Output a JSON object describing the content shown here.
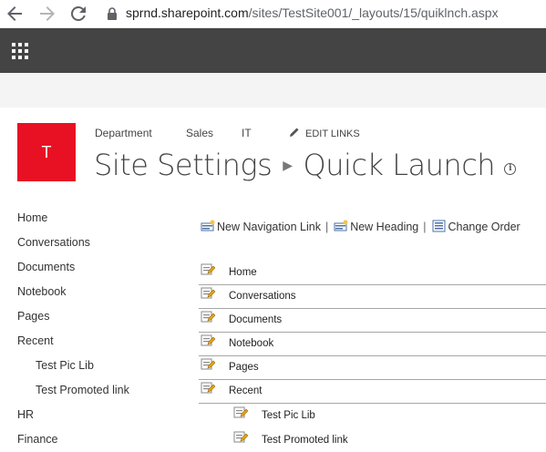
{
  "browser": {
    "url_host": "sprnd.sharepoint.com",
    "url_path": "/sites/TestSite001/_layouts/15/quiklnch.aspx"
  },
  "site": {
    "logo_letter": "T",
    "logo_color": "#e81123",
    "top_nav": [
      "Department",
      "Sales",
      "IT"
    ],
    "edit_links_label": "EDIT LINKS",
    "title_part1": "Site Settings",
    "title_part2": "Quick Launch"
  },
  "left_nav": {
    "items": [
      {
        "label": "Home",
        "level": 0
      },
      {
        "label": "Conversations",
        "level": 0
      },
      {
        "label": "Documents",
        "level": 0
      },
      {
        "label": "Notebook",
        "level": 0
      },
      {
        "label": "Pages",
        "level": 0
      },
      {
        "label": "Recent",
        "level": 0
      },
      {
        "label": "Test Pic Lib",
        "level": 1
      },
      {
        "label": "Test Promoted link",
        "level": 1
      },
      {
        "label": "HR",
        "level": 0
      },
      {
        "label": "Finance",
        "level": 0
      }
    ]
  },
  "toolbar": {
    "new_link": "New Navigation Link",
    "new_heading": "New Heading",
    "change_order": "Change Order",
    "separator": "|"
  },
  "links": [
    {
      "label": "Home",
      "level": 0
    },
    {
      "label": "Conversations",
      "level": 0
    },
    {
      "label": "Documents",
      "level": 0
    },
    {
      "label": "Notebook",
      "level": 0
    },
    {
      "label": "Pages",
      "level": 0
    },
    {
      "label": "Recent",
      "level": 0
    },
    {
      "label": "Test Pic Lib",
      "level": 1
    },
    {
      "label": "Test Promoted link",
      "level": 1
    }
  ],
  "icons": {
    "back": "arrow-left-icon",
    "forward": "arrow-right-icon",
    "reload": "reload-icon",
    "lock": "lock-icon",
    "app_launcher": "waffle-icon",
    "edit": "pencil-icon",
    "edit_link": "edit-link-icon",
    "info": "info-icon"
  }
}
